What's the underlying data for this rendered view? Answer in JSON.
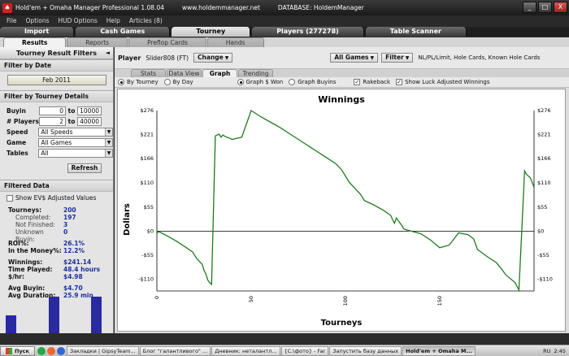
{
  "window": {
    "title": "Hold'em + Omaha Manager Professional 1.08.04",
    "site": "www.holdemmanager.net",
    "database": "DATABASE: HoldemManager",
    "controls": [
      "_",
      "□",
      "X"
    ]
  },
  "menu": [
    "File",
    "Options",
    "HUD Options",
    "Help",
    "Articles (8)"
  ],
  "main_tabs": [
    {
      "label": "Import",
      "active": false
    },
    {
      "label": "Cash Games",
      "active": false
    },
    {
      "label": "Tourney",
      "active": true
    },
    {
      "label": "Players (277278)",
      "active": false
    },
    {
      "label": "Table Scanner",
      "active": false
    }
  ],
  "sub_tabs": [
    {
      "label": "Results",
      "active": true
    },
    {
      "label": "Reports",
      "active": false
    },
    {
      "label": "Preflop Cards",
      "active": false
    },
    {
      "label": "Hands",
      "active": false
    }
  ],
  "filters": {
    "header": "Tourney Result Filters",
    "collapse_glyph": "◄",
    "by_date_title": "Filter by Date",
    "date_value": "Feb 2011",
    "by_details_title": "Filter by Tourney Details",
    "buyin_label": "Buyin",
    "buyin_from": "0",
    "buyin_to": "10000",
    "players_label": "# Players",
    "players_from": "2",
    "players_to": "40000",
    "to_label": "to",
    "speed_label": "Speed",
    "speed_value": "All Speeds",
    "game_label": "Game",
    "game_value": "All Games",
    "tables_label": "Tables",
    "tables_value": "All",
    "refresh_label": "Refresh"
  },
  "filtered_data": {
    "title": "Filtered Data",
    "show_ev_label": "Show EV$ Adjusted Values",
    "tourneys_label": "Tourneys:",
    "tourneys": "200",
    "completed_label": "Completed:",
    "completed": "197",
    "not_finished_label": "Not Finished:",
    "not_finished": "3",
    "unknown_label": "Unknown Buyin:",
    "unknown": "0",
    "roi_label": "ROI%:",
    "roi": "26.1%",
    "itm_label": "In the Money%:",
    "itm": "12.2%",
    "winnings_label": "Winnings:",
    "winnings": "$241.14",
    "time_label": "Time Played:",
    "time": "48.4 hours",
    "shr_label": "$/hr:",
    "shr": "$4.98",
    "avg_buyin_label": "Avg Buyin:",
    "avg_buyin": "$4.70",
    "avg_dur_label": "Avg Duration:",
    "avg_dur": "25.9 min",
    "mini_bars": [
      0.48,
      0.98,
      0.98
    ]
  },
  "player": {
    "label": "Player",
    "name": "Slider808 (FT)",
    "change_label": "Change",
    "games_label": "All Games",
    "filter_label": "Filter",
    "limits_text": "NL/PL/Limit, Hole Cards, Known Hole Cards"
  },
  "view_tabs": [
    {
      "label": "Stats",
      "active": false
    },
    {
      "label": "Data View",
      "active": false
    },
    {
      "label": "Graph",
      "active": true
    },
    {
      "label": "Trending",
      "active": false
    }
  ],
  "graph_options": {
    "by_tourney": "By Tourney",
    "by_day": "By Day",
    "won": "Graph $ Won",
    "buyins": "Graph Buyins",
    "rakeback": "Rakeback",
    "luck": "Show Luck Adjusted Winnings"
  },
  "chart_data": {
    "type": "line",
    "title": "Winnings",
    "xlabel": "Tourneys",
    "ylabel": "Dollars",
    "xlim": [
      0,
      200
    ],
    "ylim": [
      -137,
      276
    ],
    "yticks": [
      276,
      221,
      166,
      110,
      55,
      0,
      -55,
      -110
    ],
    "ytick_labels": [
      "$276",
      "$221",
      "$166",
      "$110",
      "$55",
      "$0",
      "-$55",
      "-$110"
    ],
    "xticks": [
      0,
      50,
      100,
      150
    ],
    "grid": false,
    "series_color": "#1e7a1e",
    "x": [
      0,
      1,
      5,
      10,
      15,
      19,
      21,
      24,
      25,
      26,
      27,
      28,
      29,
      31,
      33,
      34,
      35,
      36,
      40,
      45,
      50,
      55,
      60,
      65,
      70,
      75,
      80,
      85,
      90,
      95,
      98,
      100,
      102,
      105,
      108,
      110,
      115,
      120,
      124,
      125,
      126,
      127,
      128,
      130,
      131,
      133,
      135,
      140,
      145,
      150,
      155,
      160,
      165,
      168,
      169,
      170,
      175,
      180,
      183,
      185,
      190,
      192,
      195,
      196,
      198,
      199,
      200
    ],
    "y": [
      -5,
      -1,
      -10,
      -22,
      -36,
      -48,
      -62,
      -76,
      -90,
      -98,
      -112,
      -118,
      -122,
      218,
      222,
      215,
      220,
      217,
      210,
      215,
      276,
      262,
      250,
      238,
      224,
      210,
      196,
      182,
      168,
      154,
      140,
      126,
      112,
      98,
      84,
      70,
      60,
      48,
      36,
      26,
      18,
      30,
      24,
      12,
      5,
      2,
      0,
      -6,
      -20,
      -38,
      -32,
      -4,
      -8,
      -18,
      -30,
      -42,
      -58,
      -72,
      -88,
      -100,
      -118,
      -135,
      138,
      130,
      122,
      112,
      100
    ]
  },
  "taskbar": {
    "start": "Пуск",
    "tasks": [
      {
        "label": "Закладки | GipsyTeam...",
        "active": false
      },
      {
        "label": "Блог \"галантливого\" ...",
        "active": false
      },
      {
        "label": "Дневник: неталантл...",
        "active": false
      },
      {
        "label": "{C:\\фото} - Far",
        "active": false
      },
      {
        "label": "Запустить базу данных",
        "active": false
      },
      {
        "label": "Hold'em + Omaha M...",
        "active": true
      }
    ],
    "lang": "RU",
    "clock": "2:45"
  }
}
